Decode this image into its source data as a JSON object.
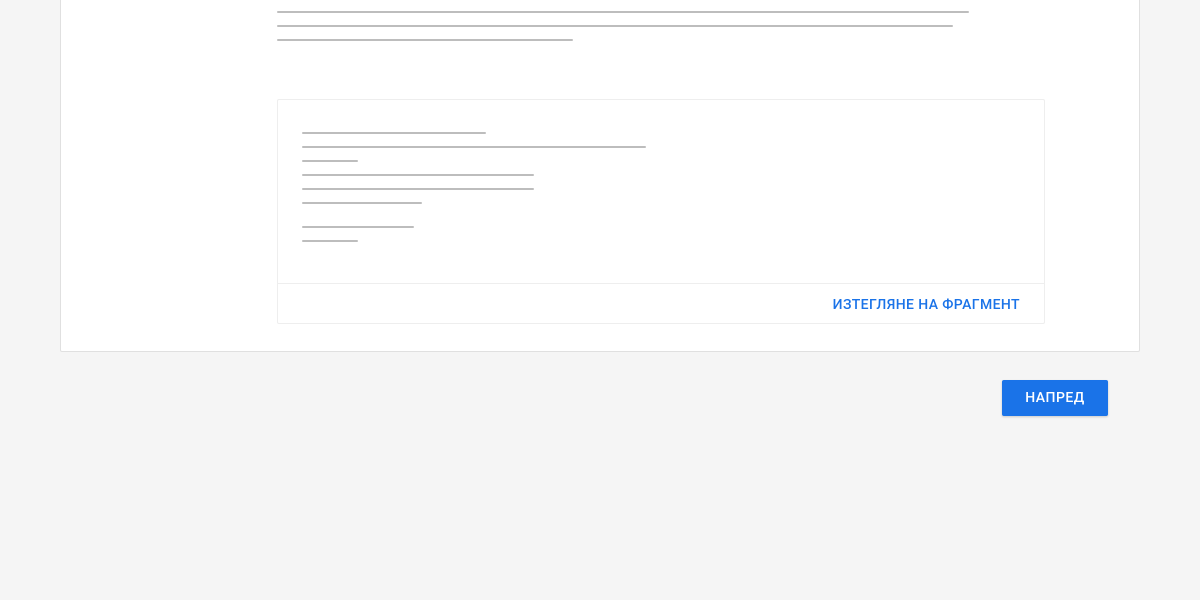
{
  "snippet": {
    "download_label": "ИЗТЕГЛЯНЕ НА ФРАГМЕНТ"
  },
  "nav": {
    "next_label": "НАПРЕД"
  }
}
